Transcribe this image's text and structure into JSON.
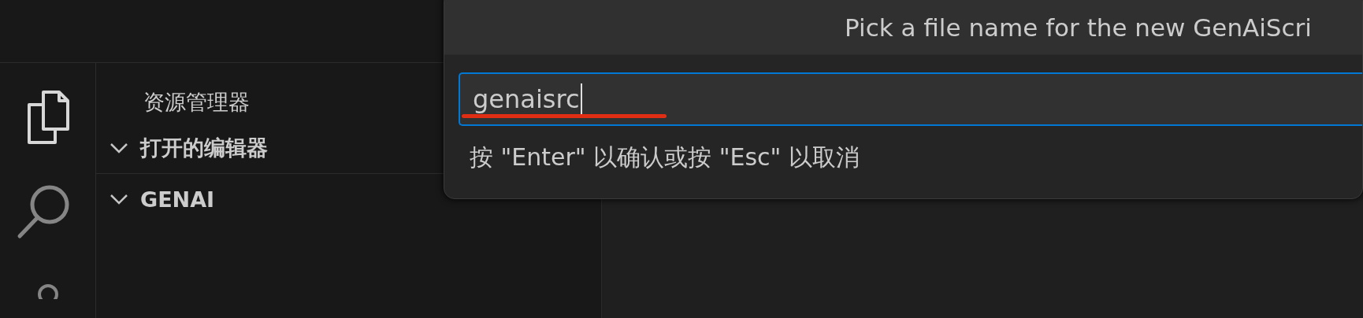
{
  "activity_bar": {
    "items": [
      {
        "kind": "explorer",
        "selected": true
      },
      {
        "kind": "search",
        "selected": false
      },
      {
        "kind": "account",
        "selected": false
      }
    ]
  },
  "sidebar": {
    "title": "资源管理器",
    "sections": [
      {
        "label": "打开的编辑器",
        "expanded": true
      },
      {
        "label": "GENAI",
        "expanded": true
      }
    ]
  },
  "quick_input": {
    "title": "Pick a file name for the new GenAiScri",
    "value": "genaisrc",
    "underlined": true,
    "hint": "按 \"Enter\" 以确认或按 \"Esc\" 以取消"
  }
}
